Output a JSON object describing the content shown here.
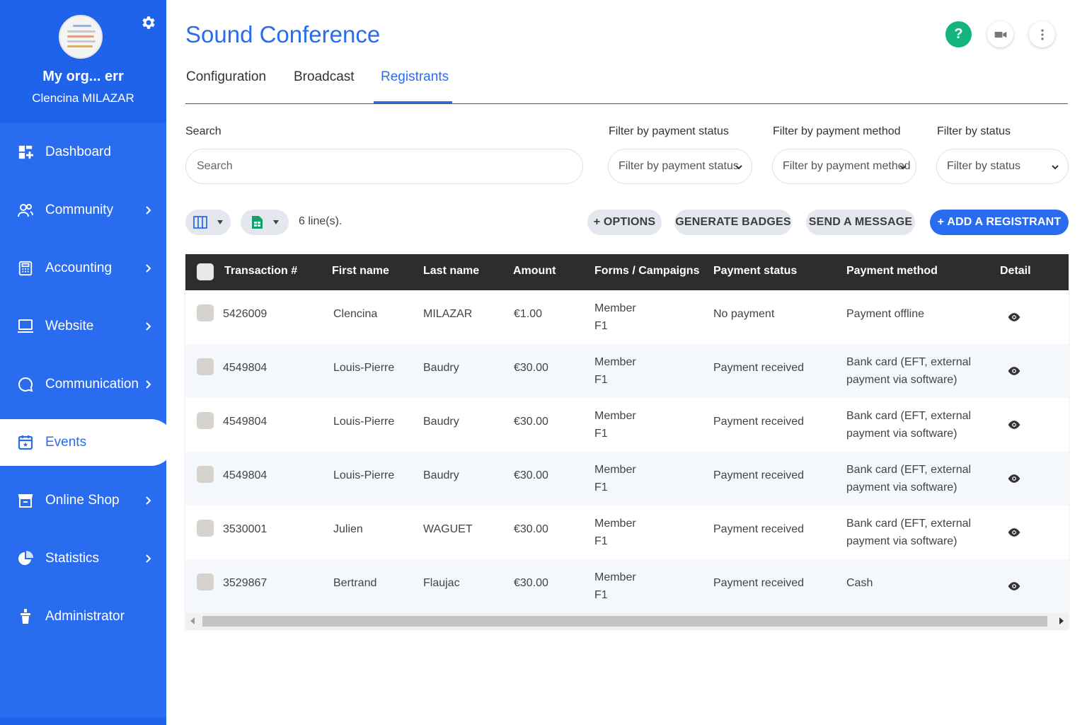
{
  "sidebar": {
    "org_name": "My org... err",
    "user_name": "Clencina MILAZAR",
    "items": [
      {
        "label": "Dashboard",
        "icon": "dashboard-icon"
      },
      {
        "label": "Community",
        "icon": "community-icon"
      },
      {
        "label": "Accounting",
        "icon": "calculator-icon"
      },
      {
        "label": "Website",
        "icon": "monitor-icon"
      },
      {
        "label": "Communication",
        "icon": "chat-icon"
      },
      {
        "label": "Events",
        "icon": "calendar-icon",
        "active": true
      },
      {
        "label": "Online Shop",
        "icon": "shop-icon"
      },
      {
        "label": "Statistics",
        "icon": "pie-chart-icon"
      },
      {
        "label": "Administrator",
        "icon": "admin-icon"
      }
    ]
  },
  "header": {
    "title": "Sound Conference",
    "help_label": "?"
  },
  "tabs": [
    {
      "label": "Configuration"
    },
    {
      "label": "Broadcast"
    },
    {
      "label": "Registrants",
      "active": true
    }
  ],
  "filters": {
    "search_label": "Search",
    "search_placeholder": "Search",
    "payment_status_label": "Filter by payment status",
    "payment_status_value": "Filter by payment status",
    "payment_method_label": "Filter by payment method",
    "payment_method_value": "Filter by payment method",
    "status_label": "Filter by status",
    "status_value": "Filter by status"
  },
  "toolbar": {
    "lines_count": "6 line(s).",
    "options_label": "+ OPTIONS",
    "badges_label": "GENERATE BADGES",
    "message_label": "SEND A MESSAGE",
    "add_label": "+ ADD A REGISTRANT"
  },
  "table": {
    "columns": {
      "transaction": "Transaction #",
      "first_name": "First name",
      "last_name": "Last name",
      "amount": "Amount",
      "forms": "Forms / Campaigns",
      "payment_status": "Payment status",
      "payment_method": "Payment method",
      "detail": "Detail"
    },
    "rows": [
      {
        "transaction": "5426009",
        "first_name": "Clencina",
        "last_name": "MILAZAR",
        "amount": "€1.00",
        "form_line1": "Member",
        "form_line2": "F1",
        "payment_status": "No payment",
        "method_line1": "Payment offline",
        "method_line2": ""
      },
      {
        "transaction": "4549804",
        "first_name": "Louis-Pierre",
        "last_name": "Baudry",
        "amount": "€30.00",
        "form_line1": "Member",
        "form_line2": "F1",
        "payment_status": "Payment received",
        "method_line1": "Bank card (EFT, external",
        "method_line2": "payment via software)"
      },
      {
        "transaction": "4549804",
        "first_name": "Louis-Pierre",
        "last_name": "Baudry",
        "amount": "€30.00",
        "form_line1": "Member",
        "form_line2": "F1",
        "payment_status": "Payment received",
        "method_line1": "Bank card (EFT, external",
        "method_line2": "payment via software)"
      },
      {
        "transaction": "4549804",
        "first_name": "Louis-Pierre",
        "last_name": "Baudry",
        "amount": "€30.00",
        "form_line1": "Member",
        "form_line2": "F1",
        "payment_status": "Payment received",
        "method_line1": "Bank card (EFT, external",
        "method_line2": "payment via software)"
      },
      {
        "transaction": "3530001",
        "first_name": "Julien",
        "last_name": "WAGUET",
        "amount": "€30.00",
        "form_line1": "Member",
        "form_line2": "F1",
        "payment_status": "Payment received",
        "method_line1": "Bank card (EFT, external",
        "method_line2": "payment via software)"
      },
      {
        "transaction": "3529867",
        "first_name": "Bertrand",
        "last_name": "Flaujac",
        "amount": "€30.00",
        "form_line1": "Member",
        "form_line2": "F1",
        "payment_status": "Payment received",
        "method_line1": "Cash",
        "method_line2": ""
      }
    ]
  },
  "colors": {
    "brand": "#2a6cf0",
    "sidebar_head": "#1f63ea",
    "help": "#13b47f",
    "table_header": "#2d2d2d"
  }
}
